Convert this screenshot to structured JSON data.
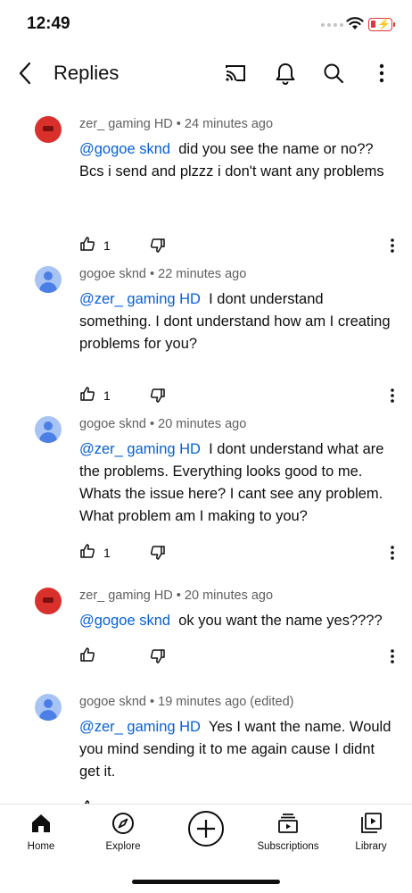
{
  "status": {
    "time": "12:49",
    "battery_color": "#e0373a"
  },
  "header": {
    "title": "Replies",
    "icons": [
      "back-arrow-icon",
      "cast-icon",
      "notifications-bell-icon",
      "search-icon",
      "more-vert-icon"
    ]
  },
  "comments": [
    {
      "author": "zer_ gaming HD",
      "time": "24 minutes ago",
      "mention": "@gogoe sknd",
      "text": "did you see the name or no?? Bcs i send and plzzz i don't want any problems",
      "likes": "1",
      "avatar": "red"
    },
    {
      "author": "gogoe sknd",
      "time": "22 minutes ago",
      "mention": "@zer_ gaming HD",
      "text": "I dont understand something. I dont understand how am I creating problems for you?",
      "likes": "1",
      "avatar": "blue"
    },
    {
      "author": "gogoe sknd",
      "time": "20 minutes ago",
      "mention": "@zer_ gaming HD",
      "text": "I dont understand what are the problems. Everything looks good to me. Whats the issue here? I cant see any problem. What problem am I making to you?",
      "likes": "1",
      "avatar": "blue"
    },
    {
      "author": "zer_ gaming HD",
      "time": "20 minutes ago",
      "mention": "@gogoe sknd",
      "text": "ok you want the name yes????",
      "likes": "",
      "avatar": "red"
    },
    {
      "author": "gogoe sknd",
      "time": "19 minutes ago (edited)",
      "mention": "@zer_ gaming HD",
      "text": "Yes I want the name. Would you mind sending it to me again cause I didnt get it.",
      "likes": "",
      "avatar": "blue"
    }
  ],
  "meta_separator": "•",
  "bottom_nav": {
    "home": "Home",
    "explore": "Explore",
    "subscriptions": "Subscriptions",
    "library": "Library"
  }
}
